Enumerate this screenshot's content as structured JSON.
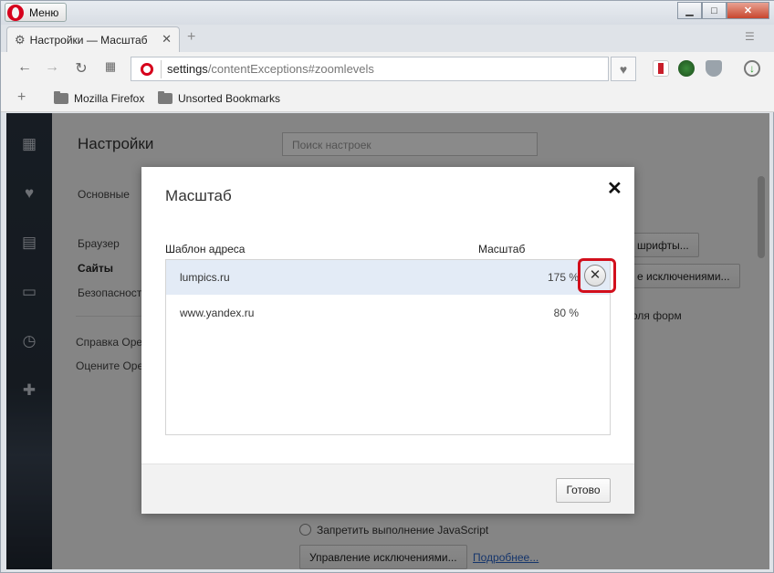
{
  "titlebar": {
    "menu_label": "Меню",
    "min": "▁",
    "max": "□",
    "close": "✕"
  },
  "tab": {
    "title": "Настройки — Масштаб",
    "close": "✕",
    "new_tab": "+"
  },
  "address": {
    "host": "settings",
    "path": "/contentExceptions#zoomlevels"
  },
  "bookmarks": {
    "add": "+",
    "items": [
      "Mozilla Firefox",
      "Unsorted Bookmarks"
    ]
  },
  "sidebar": {
    "icons": [
      "speed-dial-icon",
      "heart-icon",
      "news-icon",
      "devices-icon",
      "clock-icon",
      "puzzle-icon"
    ]
  },
  "settings": {
    "title": "Настройки",
    "search_placeholder": "Поиск настроек",
    "nav": [
      "Основные",
      "Браузер",
      "Сайты",
      "Безопасность"
    ],
    "links": [
      "Справка Opera",
      "Оцените Opera"
    ],
    "bg_buttons": [
      "шрифты...",
      "е исключениями..."
    ],
    "bg_text": "оля форм",
    "js_block": "Запретить выполнение JavaScript",
    "manage_exceptions": "Управление исключениями...",
    "more_link": "Подробнее..."
  },
  "dialog": {
    "title": "Масштаб",
    "close": "✕",
    "col_pattern": "Шаблон адреса",
    "col_zoom": "Масштаб",
    "rows": [
      {
        "site": "lumpics.ru",
        "zoom": "175 %"
      },
      {
        "site": "www.yandex.ru",
        "zoom": "80 %"
      }
    ],
    "remove": "✕",
    "done": "Готово"
  },
  "colors": {
    "accent_red": "#d20f1c",
    "sidebar": "#2b3542",
    "link": "#2a64c8"
  }
}
